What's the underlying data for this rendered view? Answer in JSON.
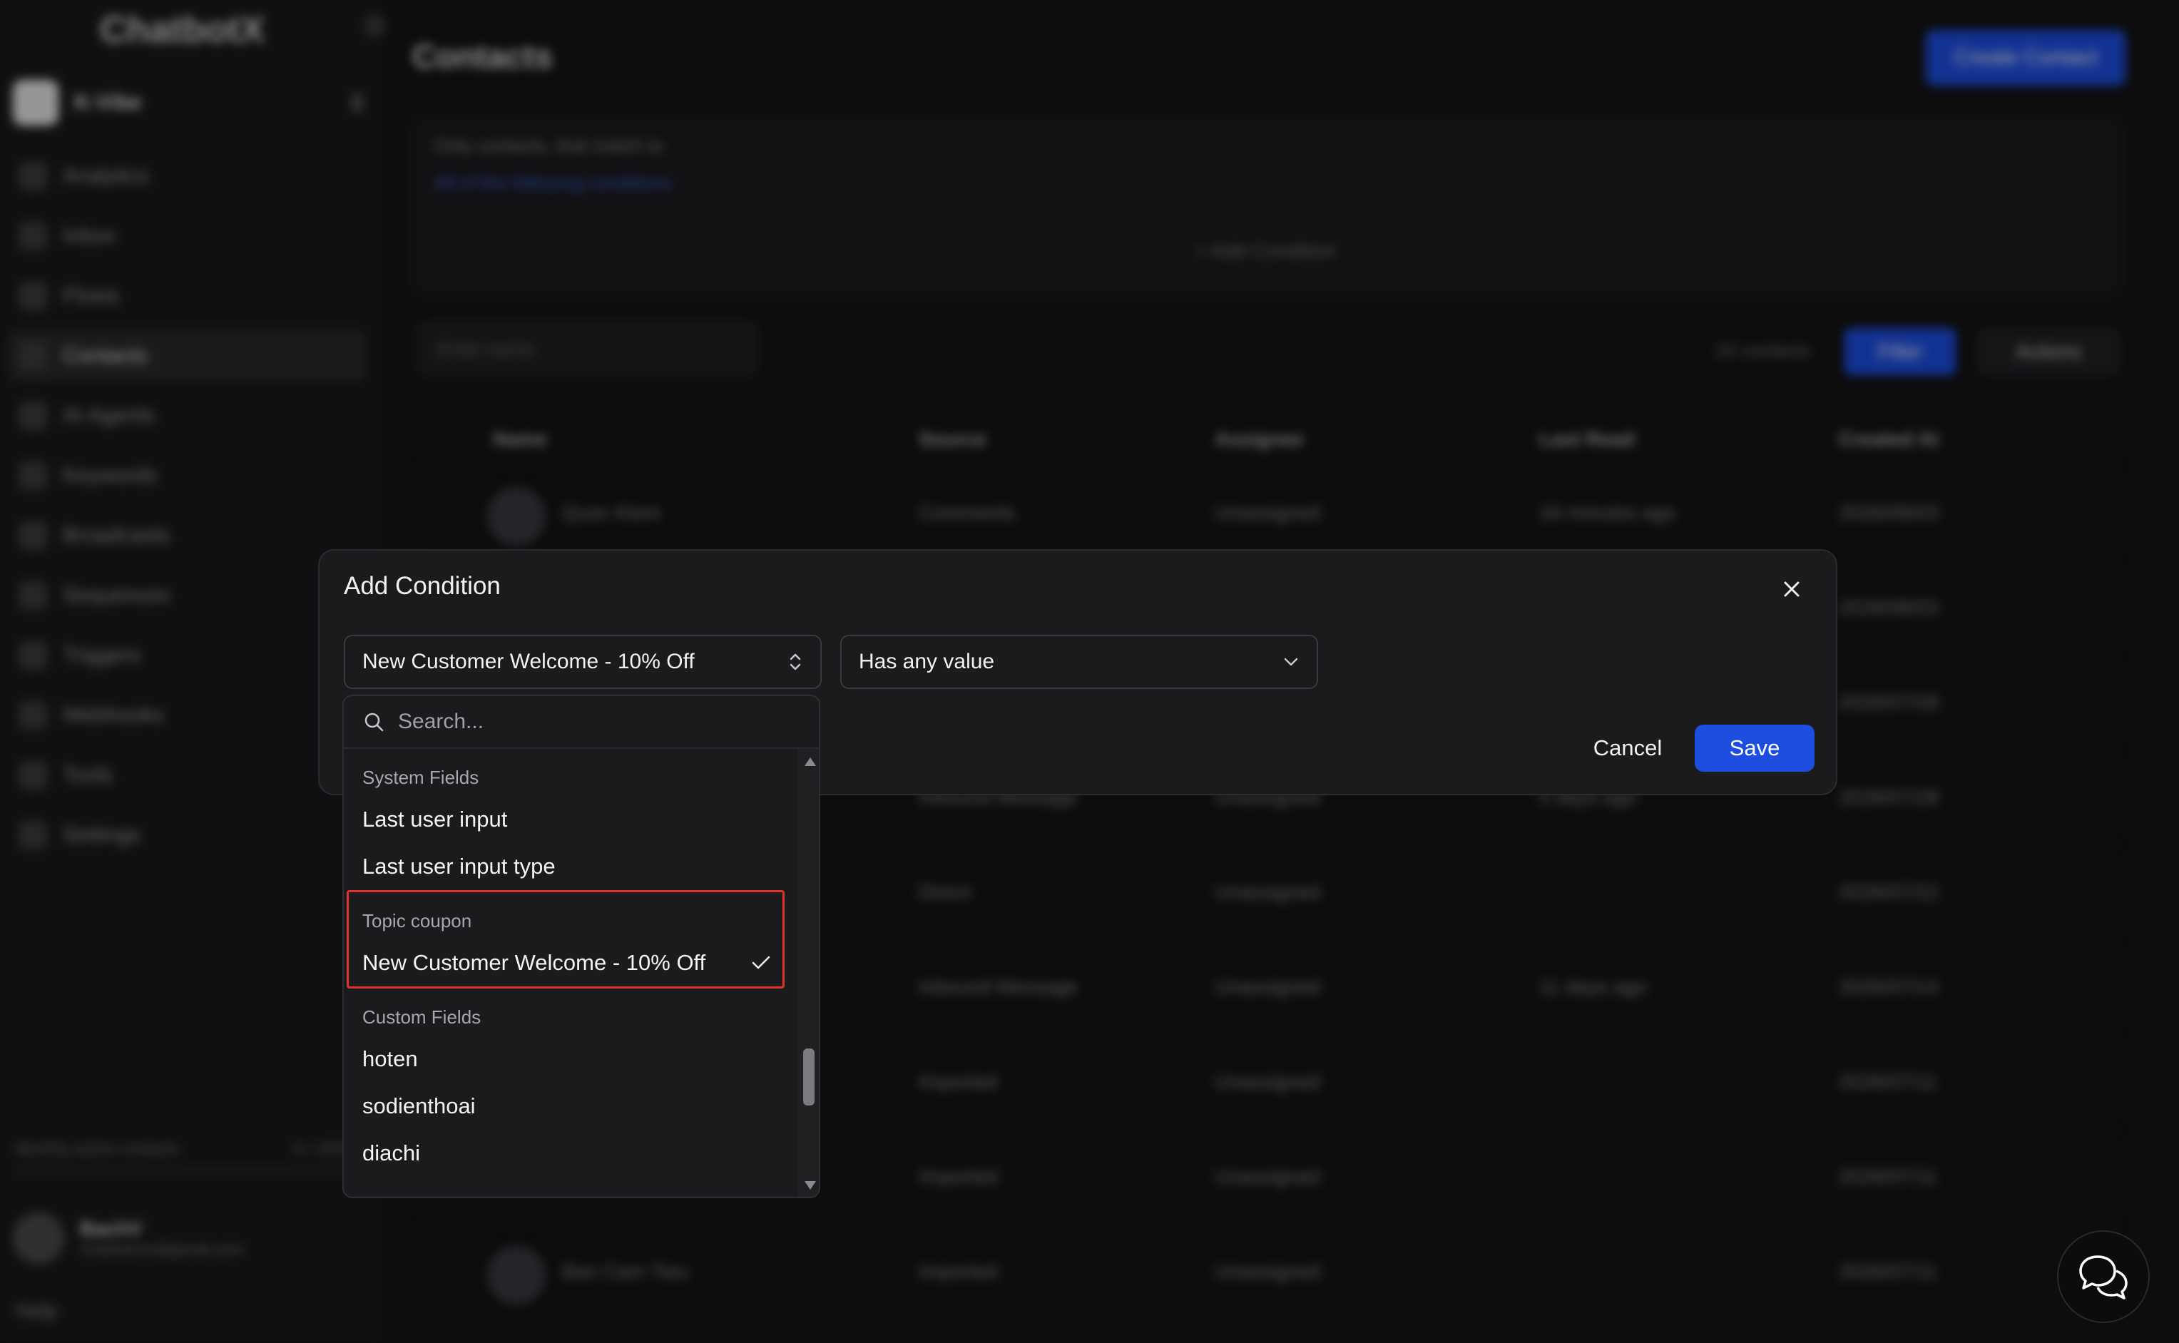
{
  "sidebar": {
    "brand": "ChatbotX",
    "workspace_name": "K-Vibe",
    "nav": [
      {
        "label": "Analytics",
        "icon": "chart-icon"
      },
      {
        "label": "Inbox",
        "icon": "chat-icon"
      },
      {
        "label": "Flows",
        "icon": "flow-icon"
      },
      {
        "label": "Contacts",
        "icon": "contacts-icon",
        "active": true
      },
      {
        "label": "AI Agents",
        "icon": "robot-icon"
      },
      {
        "label": "Keywords",
        "icon": "keyword-icon"
      },
      {
        "label": "Broadcasts",
        "icon": "broadcast-icon"
      },
      {
        "label": "Sequences",
        "icon": "sequence-icon"
      },
      {
        "label": "Triggers",
        "icon": "bulb-icon"
      },
      {
        "label": "Webhooks",
        "icon": "webhook-icon"
      },
      {
        "label": "Tools",
        "icon": "wrench-icon"
      },
      {
        "label": "Settings",
        "icon": "gear-icon"
      }
    ],
    "monthly_active_label": "Monthly active contacts",
    "monthly_active_count": "0 / 1000",
    "user_name": "BachV",
    "user_email": "chatbotxvn@gmail.com",
    "help_label": "Help"
  },
  "main": {
    "title": "Contacts",
    "create_button": "Create Contact",
    "filter_text": "Only contacts, that match to",
    "filter_link": "All of the following conditions",
    "add_condition_label": "+ Add Condition",
    "search_placeholder": "Enter name",
    "contacts_count": "24 contacts",
    "filter_button": "Filter",
    "actions_button": "Actions",
    "columns": [
      "Name",
      "Source",
      "Assignee",
      "Last Read",
      "Created At"
    ],
    "rows": [
      {
        "name": "Quoc Kiem",
        "source": "Comments",
        "assignee": "Unassigned",
        "last_read": "16 minutes ago",
        "created": "2026/08/03"
      },
      {
        "name": "",
        "source": "",
        "assignee": "",
        "last_read": "",
        "created": "2026/08/03"
      },
      {
        "name": "",
        "source": "",
        "assignee": "",
        "last_read": "",
        "created": "2026/07/28"
      },
      {
        "name": "",
        "source": "Inbound Message",
        "assignee": "Unassigned",
        "last_read": "5 days ago",
        "created": "2026/07/28"
      },
      {
        "name": "",
        "source": "Direct",
        "assignee": "Unassigned",
        "last_read": "",
        "created": "2026/07/22"
      },
      {
        "name": "",
        "source": "Inbound Message",
        "assignee": "Unassigned",
        "last_read": "11 days ago",
        "created": "2026/07/14"
      },
      {
        "name": "",
        "source": "Imported",
        "assignee": "Unassigned",
        "last_read": "",
        "created": "2026/07/11"
      },
      {
        "name": "",
        "source": "Imported",
        "assignee": "Unassigned",
        "last_read": "",
        "created": "2026/07/11"
      },
      {
        "name": "Ban Cam Tieu",
        "source": "Imported",
        "assignee": "Unassigned",
        "last_read": "",
        "created": "2026/07/11"
      }
    ]
  },
  "modal": {
    "title": "Add Condition",
    "field_select_value": "New Customer Welcome - 10% Off",
    "operator_select_value": "Has any value",
    "cancel_label": "Cancel",
    "save_label": "Save"
  },
  "dropdown": {
    "search_placeholder": "Search...",
    "groups": [
      {
        "label": "System Fields",
        "items": [
          "Last user input",
          "Last user input type"
        ]
      },
      {
        "label": "Topic coupon",
        "items": [
          "New Customer Welcome - 10% Off"
        ],
        "highlighted": true,
        "selected": "New Customer Welcome - 10% Off"
      },
      {
        "label": "Custom Fields",
        "items": [
          "hoten",
          "sodienthoai",
          "diachi"
        ]
      }
    ]
  },
  "colors": {
    "accent": "#1d4ee0",
    "highlight_border": "#e0322d",
    "modal_bg": "#1b1b1d"
  }
}
